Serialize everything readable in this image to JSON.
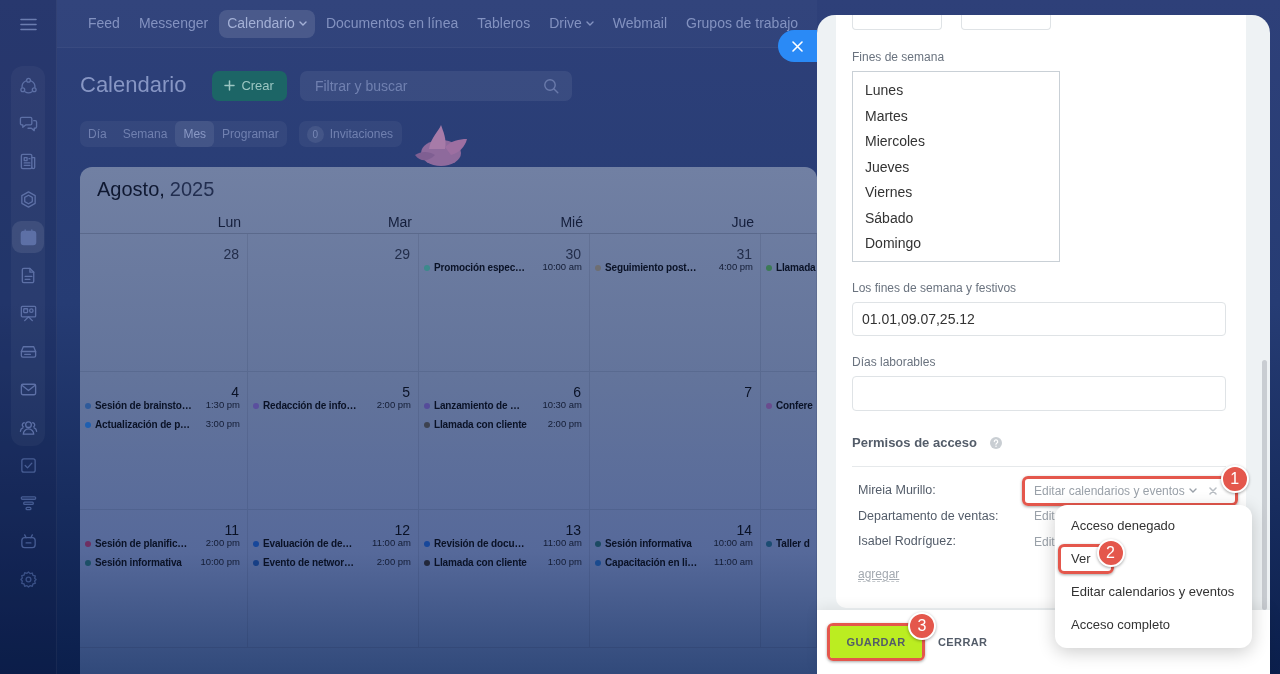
{
  "top_nav": {
    "items": [
      {
        "label": "Feed",
        "selected": false,
        "has_menu": false
      },
      {
        "label": "Messenger",
        "selected": false,
        "has_menu": false
      },
      {
        "label": "Calendario",
        "selected": true,
        "has_menu": true
      },
      {
        "label": "Documentos en línea",
        "selected": false,
        "has_menu": false
      },
      {
        "label": "Tableros",
        "selected": false,
        "has_menu": false
      },
      {
        "label": "Drive",
        "selected": false,
        "has_menu": true
      },
      {
        "label": "Webmail",
        "selected": false,
        "has_menu": false
      },
      {
        "label": "Grupos de trabajo",
        "selected": false,
        "has_menu": false
      }
    ]
  },
  "sidebar": {
    "items": [
      {
        "selected": false
      },
      {
        "selected": false
      },
      {
        "selected": false
      },
      {
        "selected": false
      },
      {
        "selected": true
      },
      {
        "selected": false
      },
      {
        "selected": false
      },
      {
        "selected": false
      },
      {
        "selected": false
      },
      {
        "selected": false
      },
      {
        "selected": false
      },
      {
        "selected": false
      },
      {
        "selected": false
      },
      {
        "selected": false
      }
    ]
  },
  "page": {
    "title": "Calendario",
    "create_button": "Crear",
    "search": {
      "placeholder": "Filtrar y buscar"
    },
    "views": [
      {
        "label": "Día",
        "selected": false
      },
      {
        "label": "Semana",
        "selected": false
      },
      {
        "label": "Mes",
        "selected": true
      },
      {
        "label": "Programar",
        "selected": false
      }
    ],
    "invitations": {
      "count": "0",
      "label": "Invitaciones"
    }
  },
  "calendar": {
    "month": "Agosto,",
    "year": "2025",
    "weekdays": [
      "Lun",
      "Mar",
      "Mié",
      "Jue"
    ],
    "weeks": [
      {
        "days": [
          {
            "number": "28",
            "other_month": true
          },
          {
            "number": "29",
            "other_month": true
          },
          {
            "number": "30",
            "other_month": true,
            "events": [
              {
                "title": "Promoción espec…",
                "time": "10:00 am",
                "color": "#3c8a8c"
              }
            ]
          },
          {
            "number": "31",
            "other_month": true,
            "events": [
              {
                "title": "Seguimiento post…",
                "time": "4:00 pm",
                "color": "#6e6e72"
              }
            ]
          },
          {
            "events": [
              {
                "title": "Llamada",
                "color": "#3c7a55"
              }
            ]
          }
        ]
      },
      {
        "days": [
          {
            "number": "4",
            "other_month": false,
            "events": [
              {
                "title": "Sesión de brainsto…",
                "time": "1:30 pm",
                "color": "#2e5a9a"
              },
              {
                "title": "Actualización de p…",
                "time": "3:00 pm",
                "color": "#1f5fb0"
              }
            ]
          },
          {
            "number": "5",
            "other_month": false,
            "events": [
              {
                "title": "Redacción de info…",
                "time": "2:00 pm",
                "color": "#5a4f9e"
              }
            ]
          },
          {
            "number": "6",
            "other_month": false,
            "events": [
              {
                "title": "Lanzamiento de …",
                "time": "10:30 am",
                "color": "#554c9a"
              },
              {
                "title": "Llamada con cliente",
                "time": "2:00 pm",
                "color": "#3d4250"
              }
            ]
          },
          {
            "number": "7",
            "other_month": false
          },
          {
            "events": [
              {
                "title": "Confere",
                "color": "#6a4c8e"
              }
            ]
          }
        ]
      },
      {
        "days": [
          {
            "number": "11",
            "other_month": false,
            "events": [
              {
                "title": "Sesión de planific…",
                "time": "2:00 pm",
                "color": "#6e2f62"
              },
              {
                "title": "Sesión informativa",
                "time": "10:00 pm",
                "color": "#1c4f66"
              }
            ]
          },
          {
            "number": "12",
            "other_month": false,
            "events": [
              {
                "title": "Evaluación de de…",
                "time": "11:00 am",
                "color": "#17479a"
              },
              {
                "title": "Evento de networ…",
                "time": "2:00 pm",
                "color": "#173f85"
              }
            ]
          },
          {
            "number": "13",
            "other_month": false,
            "events": [
              {
                "title": "Revisión de docu…",
                "time": "11:00 am",
                "color": "#17479a"
              },
              {
                "title": "Llamada con cliente",
                "time": "1:00 pm",
                "color": "#23283a"
              }
            ]
          },
          {
            "number": "14",
            "other_month": false,
            "events": [
              {
                "title": "Sesión informativa",
                "time": "10:00 am",
                "color": "#1b4a62"
              },
              {
                "title": "Capacitación en li…",
                "time": "11:00 am",
                "color": "#1a4a8e"
              }
            ]
          },
          {
            "events": [
              {
                "title": "Taller d",
                "color": "#1b4c72"
              }
            ]
          }
        ]
      }
    ]
  },
  "settings_panel": {
    "time_fields": [
      {
        "kind": "select"
      },
      {
        "kind": "select"
      }
    ],
    "weekend": {
      "label": "Fines de semana",
      "options": [
        {
          "label": "Lunes",
          "selected": false
        },
        {
          "label": "Martes",
          "selected": false
        },
        {
          "label": "Miercoles",
          "selected": false
        },
        {
          "label": "Jueves",
          "selected": false
        },
        {
          "label": "Viernes",
          "selected": false
        },
        {
          "label": "Sábado",
          "selected": false
        },
        {
          "label": "Domingo",
          "selected": false
        }
      ]
    },
    "holidays": {
      "label": "Los fines de semana y festivos",
      "value": "01.01,09.07,25.12"
    },
    "workdays": {
      "label": "Días laborables"
    },
    "access": {
      "title": "Permisos de acceso",
      "rows": [
        {
          "name": "Mireia Murillo:",
          "value": "Editar calendarios y eventos",
          "controls": true,
          "callout": "1"
        },
        {
          "name": "Departamento de ventas:",
          "value": "Edit",
          "controls": false
        },
        {
          "name": "Isabel Rodríguez:",
          "value": "Edit",
          "controls": false
        }
      ],
      "add_link": "agregar"
    },
    "footer": {
      "save": "GUARDAR",
      "save_callout": "3",
      "close": "CERRAR"
    }
  },
  "access_menu": {
    "items": [
      {
        "label": "Acceso denegado",
        "selected": false
      },
      {
        "label": "Ver",
        "selected": false,
        "callout": "2"
      },
      {
        "label": "Editar calendarios y eventos",
        "selected": false
      },
      {
        "label": "Acceso completo",
        "selected": false
      }
    ]
  }
}
